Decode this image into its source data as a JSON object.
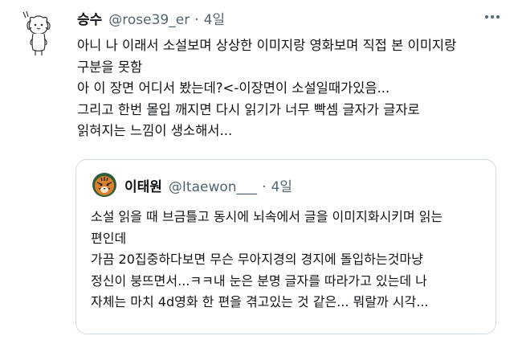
{
  "tweet": {
    "name": "승수",
    "handle": "@rose39_er",
    "separator": "·",
    "time": "4일",
    "lines": [
      "아니 나 이래서 소설보며 상상한 이미지랑 영화보며 직접 본 이미지랑",
      "구분을 못함",
      "아 이 장면 어디서 봤는데?<-이장면이 소설일때가있음...",
      "그리고 한번 몰입 깨지면 다시 읽기가 너무 빡셈 글자가 글자로",
      "읽혀지는 느낌이 생소해서..."
    ],
    "more_icon": "more-horizontal-icon"
  },
  "quote": {
    "name": "이태원",
    "handle": "@Itaewon___",
    "separator": "·",
    "time": "4일",
    "lines": [
      "소설 읽을 때 브금틀고 동시에 뇌속에서 글을 이미지화시키며 읽는",
      "편인데",
      "가끔 20집중하다보면 무슨 무아지경의 경지에 돌입하는것마냥",
      "정신이 붕뜨면서...ㅋㅋ내 눈은 분명 글자를 따라가고 있는데 나",
      "자체는 마치 4d영화 한 편을 겪고있는 것 같은... 뭐랄까 시각..."
    ]
  },
  "colors": {
    "text": "#0f1419",
    "secondary": "#536471",
    "border": "#cfd9de"
  }
}
